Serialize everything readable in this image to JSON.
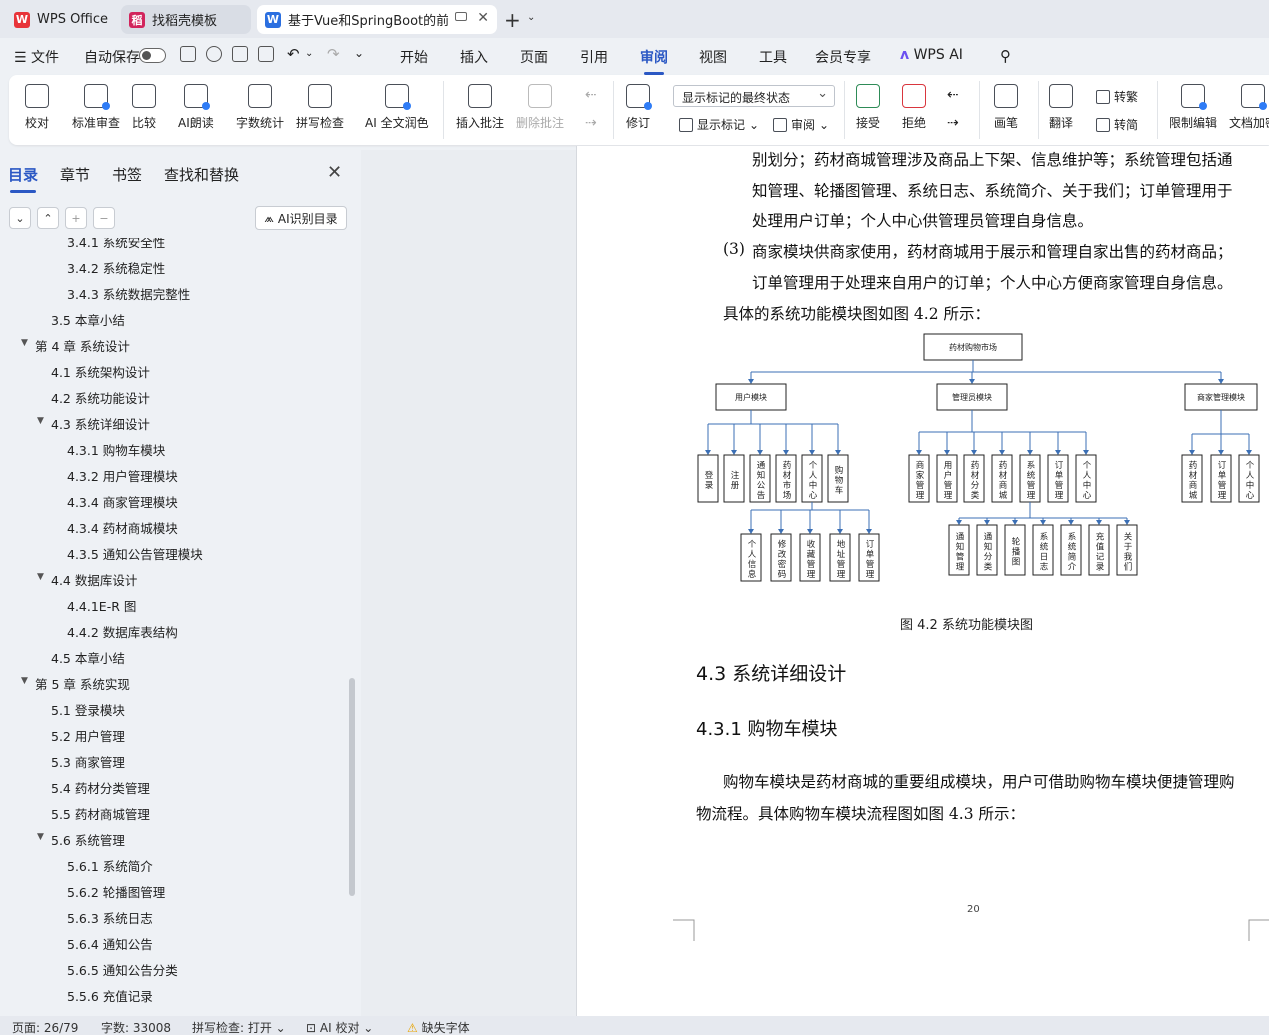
{
  "tabs": [
    {
      "label": "WPS Office",
      "icon": "wps-logo-icon",
      "color": "#e8343a"
    },
    {
      "label": "找稻壳模板",
      "icon": "docer-logo-icon",
      "color": "#d2245c"
    },
    {
      "label": "基于Vue和SpringBoot的前后",
      "icon": "word-doc-icon",
      "color": "#2b6fe0"
    }
  ],
  "menu": {
    "file": "文件",
    "autosave": "自动保存",
    "items": [
      "开始",
      "插入",
      "页面",
      "引用",
      "审阅",
      "视图",
      "工具",
      "会员专享",
      "WPS AI"
    ],
    "active": "审阅"
  },
  "ribbon": {
    "buttons": [
      "校对",
      "标准审查",
      "比较",
      "AI朗读",
      "字数统计",
      "拼写检查",
      "AI 全文润色",
      "插入批注",
      "删除批注",
      "修订",
      "接受",
      "拒绝",
      "画笔",
      "翻译",
      "限制编辑",
      "文档加密"
    ],
    "markup_select": "显示标记的最终状态",
    "show_markup": "显示标记",
    "review": "审阅",
    "trad": "转繁",
    "simp": "转简"
  },
  "sidebar": {
    "tabs": [
      "目录",
      "章节",
      "书签",
      "查找和替换"
    ],
    "ai_button": "AI识别目录",
    "toc": [
      {
        "label": "3.4.1  系统安全性",
        "level": 3
      },
      {
        "label": "3.4.2  系统稳定性",
        "level": 3
      },
      {
        "label": "3.4.3  系统数据完整性",
        "level": 3
      },
      {
        "label": "3.5  本章小结",
        "level": 2
      },
      {
        "label": "第 4 章  系统设计",
        "level": 1,
        "caret": true
      },
      {
        "label": "4.1 系统架构设计",
        "level": 2
      },
      {
        "label": "4.2 系统功能设计",
        "level": 2
      },
      {
        "label": "4.3 系统详细设计",
        "level": 2,
        "caret": true
      },
      {
        "label": "4.3.1  购物车模块",
        "level": 3
      },
      {
        "label": "4.3.2 用户管理模块",
        "level": 3
      },
      {
        "label": "4.3.4 商家管理模块",
        "level": 3
      },
      {
        "label": "4.3.4 药材商城模块",
        "level": 3
      },
      {
        "label": "4.3.5 通知公告管理模块",
        "level": 3
      },
      {
        "label": "4.4 数据库设计",
        "level": 2,
        "caret": true
      },
      {
        "label": "4.4.1E-R 图",
        "level": 3
      },
      {
        "label": "4.4.2 数据库表结构",
        "level": 3
      },
      {
        "label": "4.5 本章小结",
        "level": 2
      },
      {
        "label": "第 5 章  系统实现",
        "level": 1,
        "caret": true
      },
      {
        "label": "5.1  登录模块",
        "level": 2
      },
      {
        "label": "5.2  用户管理",
        "level": 2
      },
      {
        "label": "5.3 商家管理",
        "level": 2
      },
      {
        "label": "5.4 药材分类管理",
        "level": 2
      },
      {
        "label": "5.5 药材商城管理",
        "level": 2
      },
      {
        "label": "5.6 系统管理",
        "level": 2,
        "caret": true
      },
      {
        "label": "5.6.1 系统简介",
        "level": 3
      },
      {
        "label": "5.6.2 轮播图管理",
        "level": 3
      },
      {
        "label": "5.6.3  系统日志",
        "level": 3
      },
      {
        "label": "5.6.4 通知公告",
        "level": 3
      },
      {
        "label": "5.6.5 通知公告分类",
        "level": 3
      },
      {
        "label": "5.5.6 充值记录",
        "level": 3
      }
    ]
  },
  "document": {
    "lines": [
      "别划分；药材商城管理涉及商品上下架、信息维护等；系统管理包括通",
      "知管理、轮播图管理、系统日志、系统简介、关于我们；订单管理用于",
      "处理用户订单；个人中心供管理员管理自身信息。",
      "商家模块供商家使用，药材商城用于展示和管理自家出售的药材商品；",
      "订单管理用于处理来自用户的订单；个人中心方便商家管理自身信息。",
      "具体的系统功能模块图如图 4.2 所示："
    ],
    "list_num": "(3)",
    "diagram": {
      "root": "药材购物市场",
      "modules": [
        "用户模块",
        "管理员模块",
        "商家管理模块"
      ],
      "user_children": [
        "登录",
        "注册",
        "通知公告",
        "药材市场",
        "个人中心",
        "购物车"
      ],
      "user_sub": [
        "个人信息",
        "修改密码",
        "收藏管理",
        "地址管理",
        "订单管理"
      ],
      "admin_children": [
        "商家管理",
        "用户管理",
        "药材分类",
        "药材商城",
        "系统管理",
        "订单管理",
        "个人中心"
      ],
      "admin_sub": [
        "通知管理",
        "通知分类",
        "轮播图",
        "系统日志",
        "系统简介",
        "充值记录",
        "关于我们"
      ],
      "merchant_children": [
        "药材商城",
        "订单管理",
        "个人中心"
      ]
    },
    "caption": "图 4.2 系统功能模块图",
    "h2": "4.3 系统详细设计",
    "h3": "4.3.1  购物车模块",
    "para1": "购物车模块是药材商城的重要组成模块，用户可借助购物车模块便捷管理购",
    "para2": "物流程。具体购物车模块流程图如图 4.3 所示：",
    "page_number": "20"
  },
  "status": {
    "page": "页面: 26/79",
    "words": "字数: 33008",
    "spell": "拼写检查: 打开",
    "ai_check": "AI 校对",
    "missing_font": "缺失字体"
  }
}
